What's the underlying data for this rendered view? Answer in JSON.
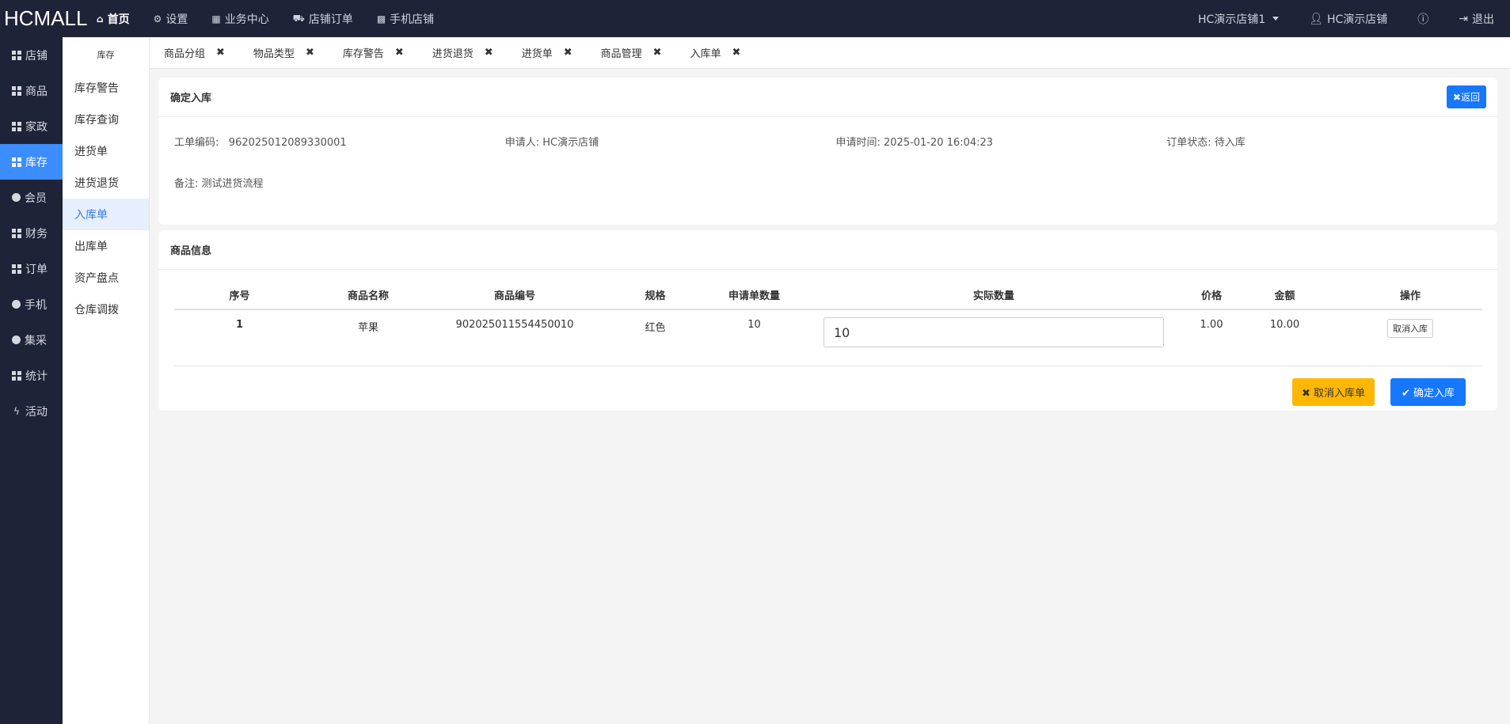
{
  "topbar": {
    "brand": "HCMALL",
    "nav": [
      {
        "label": "首页",
        "icon": "home-icon"
      },
      {
        "label": "设置",
        "icon": "gear-icon"
      },
      {
        "label": "业务中心",
        "icon": "calculator-icon"
      },
      {
        "label": "店铺订单",
        "icon": "cart-icon"
      },
      {
        "label": "手机店铺",
        "icon": "qrcode-icon"
      }
    ],
    "store_select": "HC演示店铺1",
    "user": "HC演示店铺",
    "logout": "退出"
  },
  "sidebar": {
    "items": [
      {
        "label": "店铺",
        "icon": "grid-icon"
      },
      {
        "label": "商品",
        "icon": "grid-icon"
      },
      {
        "label": "家政",
        "icon": "grid-icon"
      },
      {
        "label": "库存",
        "icon": "grid-icon"
      },
      {
        "label": "会员",
        "icon": "globe-icon"
      },
      {
        "label": "财务",
        "icon": "grid-icon"
      },
      {
        "label": "订单",
        "icon": "grid-icon"
      },
      {
        "label": "手机",
        "icon": "globe-icon"
      },
      {
        "label": "集采",
        "icon": "globe-icon"
      },
      {
        "label": "统计",
        "icon": "grid-icon"
      },
      {
        "label": "活动",
        "icon": "bolt-icon"
      }
    ]
  },
  "subsidebar": {
    "title": "库存",
    "items": [
      "库存警告",
      "库存查询",
      "进货单",
      "进货退货",
      "入库单",
      "出库单",
      "资产盘点",
      "仓库调拨"
    ]
  },
  "tabs": [
    "商品分组",
    "物品类型",
    "库存警告",
    "进货退货",
    "进货单",
    "商品管理",
    "入库单"
  ],
  "confirm_card": {
    "title": "确定入库",
    "return_label": "返回",
    "order_no_label": "工单编码:",
    "order_no": "962025012089330001",
    "applicant": "申请人: HC演示店铺",
    "apply_time": "申请时间: 2025-01-20 16:04:23",
    "status": "订单状态: 待入库",
    "remark": "备注: 测试进货流程"
  },
  "goods_card": {
    "title": "商品信息",
    "headers": [
      "序号",
      "商品名称",
      "商品编号",
      "规格",
      "申请单数量",
      "实际数量",
      "价格",
      "金额",
      "操作"
    ],
    "rows": [
      {
        "seq": "1",
        "name": "苹果",
        "code": "902025011554450010",
        "spec": "红色",
        "apply_qty": "10",
        "actual_qty": "10",
        "price": "1.00",
        "amount": "10.00",
        "action": "取消入库"
      }
    ],
    "cancel_order_label": "取消入库单",
    "confirm_label": "确定入库"
  }
}
